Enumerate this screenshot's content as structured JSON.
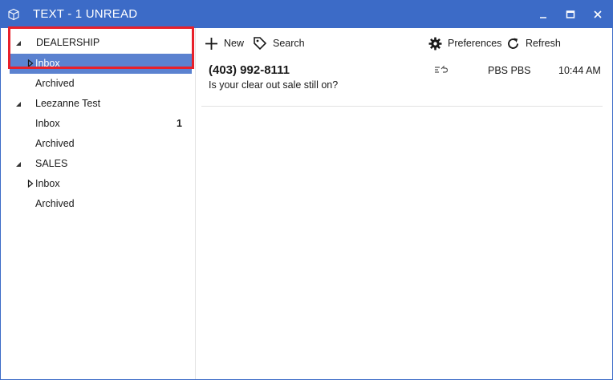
{
  "window": {
    "title": "TEXT - 1 UNREAD",
    "app_icon": "cube-icon",
    "controls": [
      "minimize-icon",
      "maximize-icon",
      "close-icon"
    ],
    "accent_color": "#3c6bc7",
    "selection_color": "#5b82d0",
    "highlight_color": "#e8202a"
  },
  "sidebar": {
    "groups": [
      {
        "name": "DEALERSHIP",
        "expanded": true,
        "items": [
          {
            "label": "Inbox",
            "selected": true,
            "count": ""
          },
          {
            "label": "Archived",
            "selected": false,
            "count": ""
          }
        ]
      },
      {
        "name": "Leezanne Test",
        "expanded": true,
        "items": [
          {
            "label": "Inbox",
            "selected": false,
            "count": "1"
          },
          {
            "label": "Archived",
            "selected": false,
            "count": ""
          }
        ]
      },
      {
        "name": "SALES",
        "expanded": true,
        "items": [
          {
            "label": "Inbox",
            "selected": false,
            "count": ""
          },
          {
            "label": "Archived",
            "selected": false,
            "count": ""
          }
        ]
      }
    ]
  },
  "toolbar": {
    "new_label": "New",
    "search_label": "Search",
    "preferences_label": "Preferences",
    "refresh_label": "Refresh"
  },
  "messages": [
    {
      "phone": "(403) 992-8111",
      "preview": "Is your clear out sale still on?",
      "status_icon": "reply-icon",
      "sender": "PBS PBS",
      "time": "10:44 AM"
    }
  ]
}
